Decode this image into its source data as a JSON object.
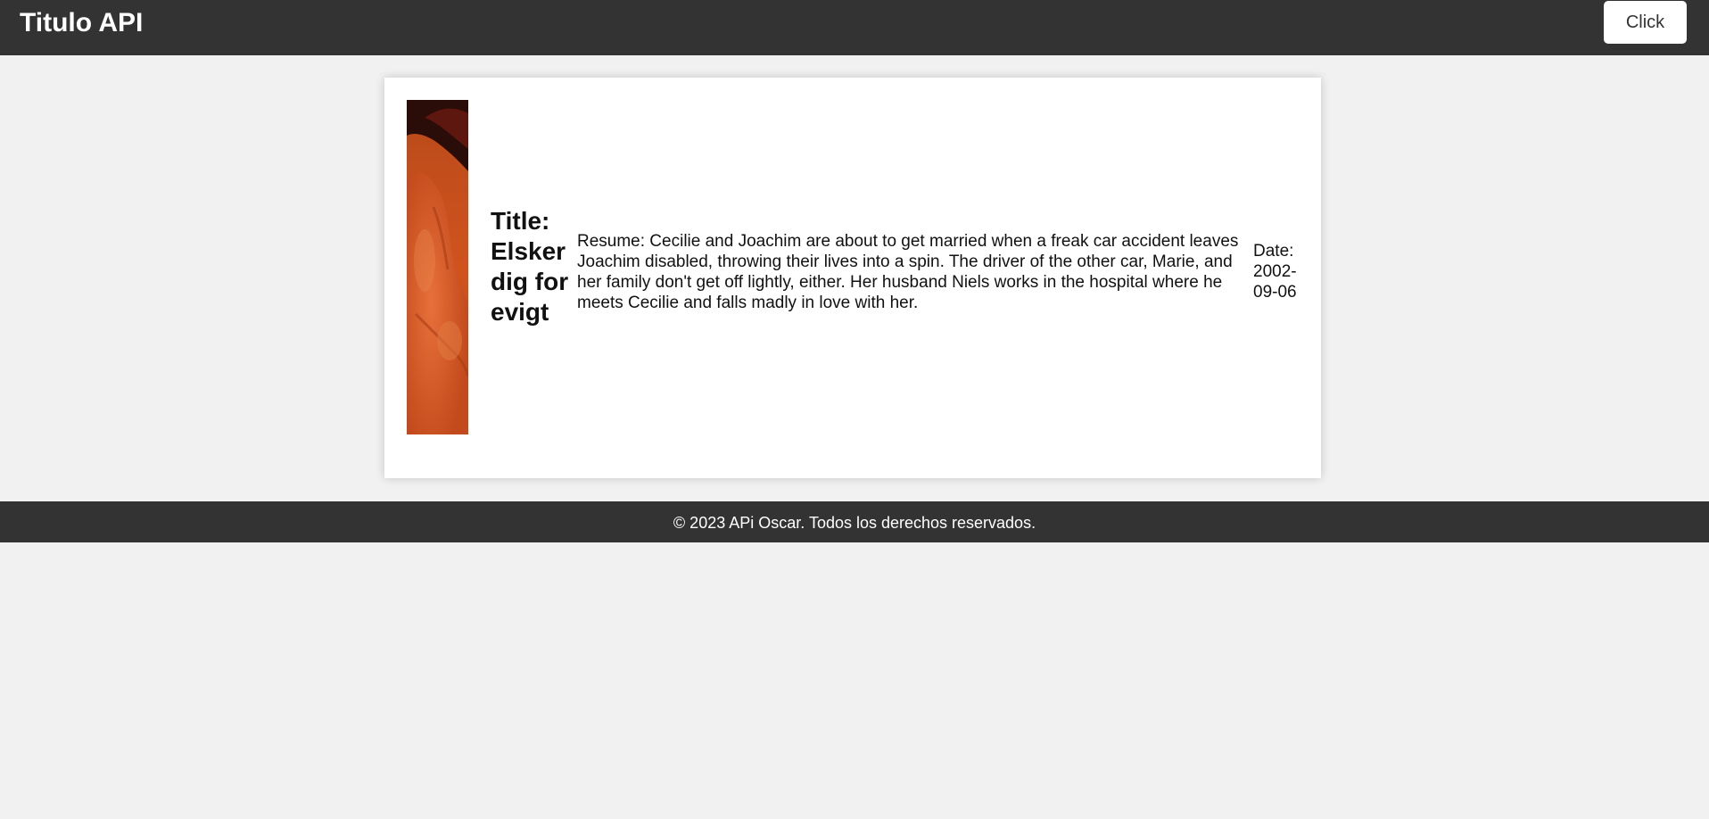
{
  "header": {
    "title": "Titulo API",
    "button_label": "Click"
  },
  "movie": {
    "title": "Title: Elsker dig for evigt",
    "resume": "Resume: Cecilie and Joachim are about to get married when a freak car accident leaves Joachim disabled, throwing their lives into a spin. The driver of the other car, Marie, and her family don't get off lightly, either. Her husband Niels works in the hospital where he meets Cecilie and falls madly in love with her.",
    "date": "Date: 2002-09-06",
    "poster_icon": "movie-poster-image"
  },
  "footer": {
    "text": "© 2023 APi Oscar. Todos los derechos reservados."
  },
  "colors": {
    "header_bg": "#333333",
    "footer_bg": "#333333",
    "page_bg": "#f1f1f1",
    "card_bg": "#ffffff",
    "button_bg": "#ffffff"
  }
}
